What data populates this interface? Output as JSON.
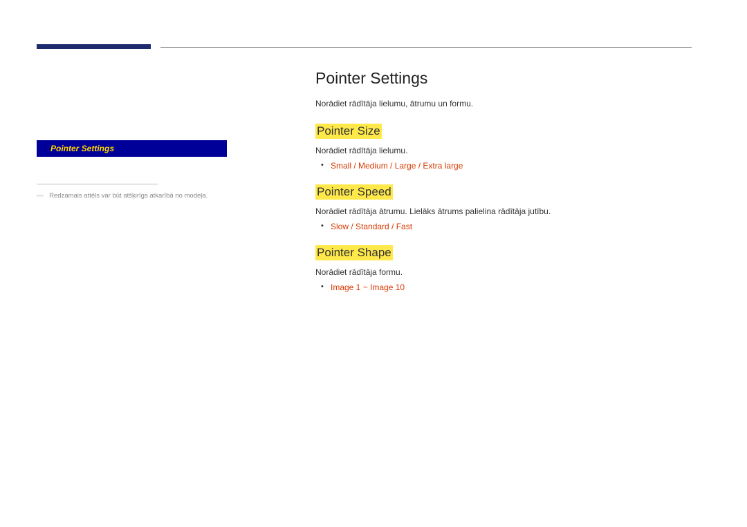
{
  "sidebar": {
    "activeItem": "Pointer Settings"
  },
  "footnote": {
    "dash": "―",
    "text": "Redzamais attēls var būt atšķirīgs atkarībā no modeļa."
  },
  "main": {
    "title": "Pointer Settings",
    "intro": "Norādiet rādītāja lielumu, ātrumu un formu.",
    "sections": [
      {
        "title": "Pointer Size",
        "desc": "Norādiet rādītāja lielumu.",
        "options": "Small / Medium / Large / Extra large"
      },
      {
        "title": "Pointer Speed",
        "desc": "Norādiet rādītāja ātrumu. Lielāks ātrums palielina rādītāja jutību.",
        "options": "Slow / Standard / Fast"
      },
      {
        "title": "Pointer Shape",
        "desc": "Norādiet rādītāja formu.",
        "options": "Image 1 ~ Image 10"
      }
    ]
  }
}
